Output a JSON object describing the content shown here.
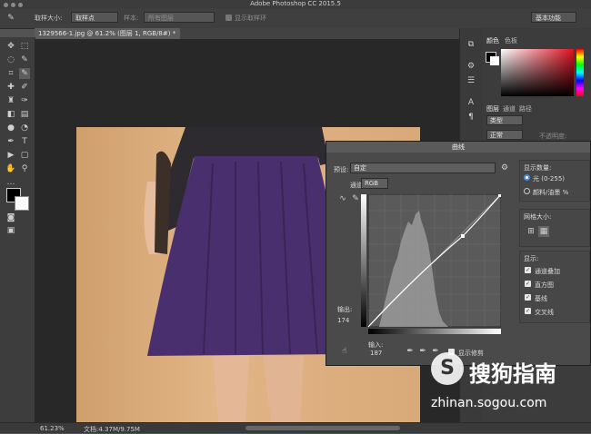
{
  "app": {
    "title": "Adobe Photoshop CC 2015.5"
  },
  "options_bar": {
    "sample_size_label": "取样大小:",
    "sample_size_value": "取样点",
    "sample_label": "样本:",
    "sample_value": "所有图层",
    "show_ring_label": "显示取样环",
    "workspace": "基本功能"
  },
  "document": {
    "tab_label": "1329566-1.jpg @ 61.2% (图层 1, RGB/8#) *",
    "close": "×"
  },
  "right_panel": {
    "tabs_top": [
      "颜色",
      "色板"
    ],
    "tabs_layers": [
      "图层",
      "通道",
      "路径"
    ],
    "kind_label": "类型",
    "blend_mode": "正常",
    "opacity_label": "不透明度:",
    "lock_label": "锁定:"
  },
  "curves": {
    "title": "曲线",
    "preset_label": "预设:",
    "preset_value": "自定",
    "channel_label": "通道:",
    "channel_value": "RGB",
    "output_label": "输出:",
    "output_value": "174",
    "input_label": "输入:",
    "input_value": "187",
    "show_clipping_label": "显示修剪",
    "display_amount_label": "显示数量:",
    "light_option": "光 (0-255)",
    "pigment_option": "颜料/油墨 %",
    "grid_size_label": "网格大小:",
    "show_label": "显示:",
    "show_options": [
      "通道叠加",
      "直方图",
      "基线",
      "交叉线"
    ],
    "buttons": [
      "确定",
      "复位",
      "平滑",
      "自动",
      "选项..."
    ]
  },
  "status": {
    "zoom": "61.23%",
    "doc_info": "文档:4.37M/9.75M"
  },
  "watermark": {
    "text": "搜狗指南",
    "url": "zhinan.sogou.com"
  },
  "colors": {
    "accent": "#4a90d9",
    "skirt": "#4a2f6e",
    "backdrop": "#dcae7e"
  }
}
